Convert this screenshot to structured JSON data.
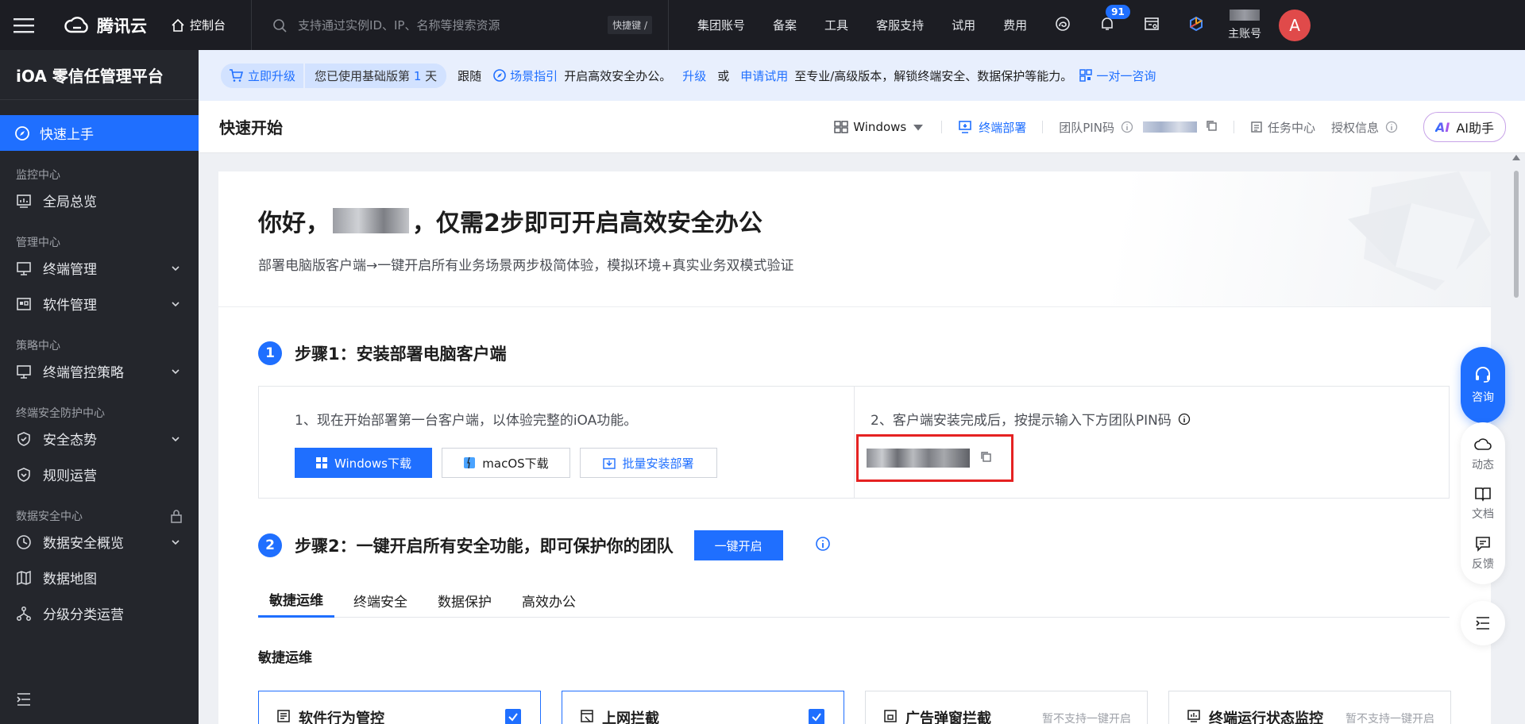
{
  "topnav": {
    "logo_text": "腾讯云",
    "console": "控制台",
    "search_placeholder": "支持通过实例ID、IP、名称等搜索资源",
    "shortcut": "快捷键 /",
    "links": [
      "集团账号",
      "备案",
      "工具",
      "客服支持",
      "试用",
      "费用"
    ],
    "notifications": "91",
    "account_label": "主账号",
    "avatar": "A"
  },
  "sidebar": {
    "brand": "iOA 零信任管理平台",
    "active": "快速上手",
    "groups": {
      "monitor": "监控中心",
      "manage": "管理中心",
      "policy": "策略中心",
      "protect": "终端安全防护中心",
      "datasec": "数据安全中心"
    },
    "items": {
      "overview": "全局总览",
      "terminal": "终端管理",
      "software": "软件管理",
      "policy": "终端管控策略",
      "posture": "安全态势",
      "rules": "规则运营",
      "data_overview": "数据安全概览",
      "data_map": "数据地图",
      "classify": "分级分类运营"
    }
  },
  "banner": {
    "upgrade": "立即升级",
    "trial_prefix": "您已使用基础版第",
    "trial_days": "1",
    "trial_suffix": "天",
    "follow": "跟随",
    "guide": "场景指引",
    "guide_suffix": "开启高效安全办公。",
    "upgrade_link": "升级",
    "or": "或",
    "apply_link": "申请试用",
    "tail": "至专业/高级版本，解锁终端安全、数据保护等能力。",
    "consult": "一对一咨询"
  },
  "header": {
    "title": "快速开始",
    "os": "Windows",
    "deploy": "终端部署",
    "pin_label": "团队PIN码",
    "task": "任务中心",
    "license": "授权信息",
    "ai": "AI助手",
    "ai_logo": "AI"
  },
  "hero": {
    "greeting": "你好，",
    "title_suffix": "，仅需2步即可开启高效安全办公",
    "subtitle": "部署电脑版客户端→一键开启所有业务场景两步极简体验，模拟环境+真实业务双模式验证"
  },
  "step1": {
    "num": "1",
    "title": "步骤1：安装部署电脑客户端",
    "left_desc": "1、现在开始部署第一台客户端，以体验完整的iOA功能。",
    "btn_windows": "Windows下载",
    "btn_mac": "macOS下载",
    "btn_batch": "批量安装部署",
    "right_desc": "2、客户端安装完成后，按提示输入下方团队PIN码"
  },
  "step2": {
    "num": "2",
    "title": "步骤2：一键开启所有安全功能，即可保护你的团队",
    "button": "一键开启"
  },
  "tabs": [
    "敏捷运维",
    "终端安全",
    "数据保护",
    "高效办公"
  ],
  "section_title": "敏捷运维",
  "cards": [
    {
      "title": "软件行为管控",
      "selected": true,
      "note": ""
    },
    {
      "title": "上网拦截",
      "selected": true,
      "note": ""
    },
    {
      "title": "广告弹窗拦截",
      "selected": false,
      "note": "暂不支持一键开启"
    },
    {
      "title": "终端运行状态监控",
      "selected": false,
      "note": "暂不支持一键开启"
    }
  ],
  "side": {
    "consult": "咨询",
    "dynamic": "动态",
    "docs": "文档",
    "feedback": "反馈"
  },
  "colors": {
    "accent": "#1f6fff",
    "nav_bg": "#1c1d23",
    "sidebar_bg": "#24262c",
    "highlight": "#e52222"
  }
}
